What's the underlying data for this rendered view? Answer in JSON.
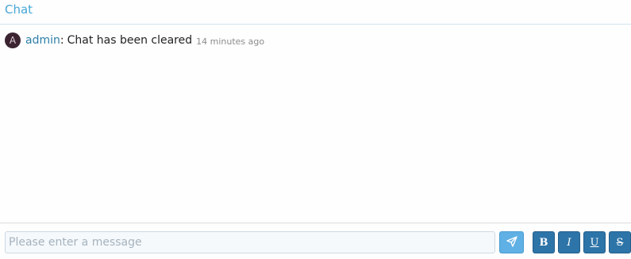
{
  "header": {
    "title": "Chat"
  },
  "messages": [
    {
      "avatar_letter": "A",
      "user": "admin",
      "separator": ":",
      "text": "Chat has been cleared",
      "time": "14 minutes ago"
    }
  ],
  "composer": {
    "placeholder": "Please enter a message",
    "value": "",
    "send_icon": "paper-plane-icon",
    "format_buttons": {
      "bold": "B",
      "italic": "I",
      "underline": "U",
      "strike": "S"
    }
  },
  "colors": {
    "title": "#47a7d6",
    "username": "#2d7fa8",
    "send_button": "#5fb0e4",
    "format_button": "#2d74a8",
    "avatar": "#3b2430"
  }
}
